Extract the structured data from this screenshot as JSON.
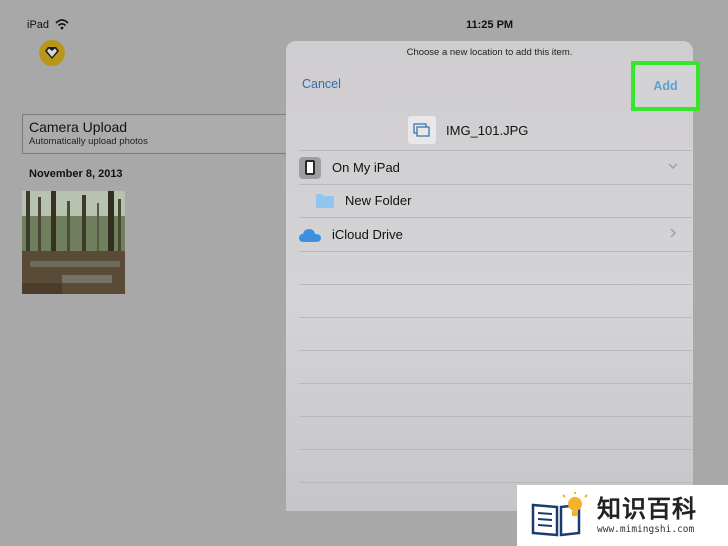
{
  "status_bar": {
    "device": "iPad",
    "time": "11:25 PM"
  },
  "background_app": {
    "section_title": "Camera Upload",
    "section_subtitle": "Automatically upload photos",
    "date": "November 8, 2013"
  },
  "sheet": {
    "prompt": "Choose a new location to add this item.",
    "cancel_label": "Cancel",
    "add_label": "Add",
    "file_name": "IMG_101.JPG",
    "locations": [
      {
        "label": "On My iPad",
        "icon": "ipad-icon",
        "chevron": "chevron-down-icon"
      },
      {
        "label": "New Folder",
        "icon": "folder-icon"
      },
      {
        "label": "iCloud Drive",
        "icon": "icloud-icon",
        "chevron": "chevron-right-icon"
      }
    ]
  },
  "watermark": {
    "brand": "知识百科",
    "url": "www.mimingshi.com"
  },
  "colors": {
    "accent_blue": "#2f6ea8",
    "highlight_green": "#35e62b",
    "app_icon_gold": "#b8961a"
  }
}
